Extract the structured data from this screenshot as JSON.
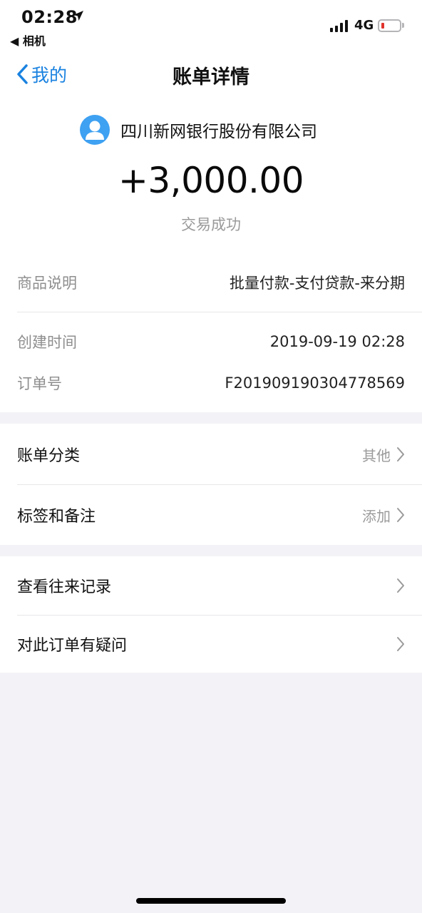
{
  "status_bar": {
    "time": "02:28",
    "back_app": "◀ 相机",
    "network": "4G"
  },
  "nav": {
    "back_label": "我的",
    "title": "账单详情"
  },
  "merchant": {
    "name": "四川新网银行股份有限公司",
    "avatar_icon": "user-avatar-icon"
  },
  "transaction": {
    "amount": "+3,000.00",
    "status": "交易成功"
  },
  "details": {
    "product_label": "商品说明",
    "product_value": "批量付款-支付贷款-来分期",
    "created_label": "创建时间",
    "created_value": "2019-09-19 02:28",
    "order_label": "订单号",
    "order_value": "F201909190304778569"
  },
  "settings": {
    "category_label": "账单分类",
    "category_value": "其他",
    "tags_label": "标签和备注",
    "tags_value": "添加"
  },
  "actions": {
    "history_label": "查看往来记录",
    "question_label": "对此订单有疑问"
  },
  "colors": {
    "accent": "#1a82e0",
    "avatar": "#3ea1f2",
    "page_bg": "#f3f3f7",
    "battery_low": "#e0332c"
  }
}
